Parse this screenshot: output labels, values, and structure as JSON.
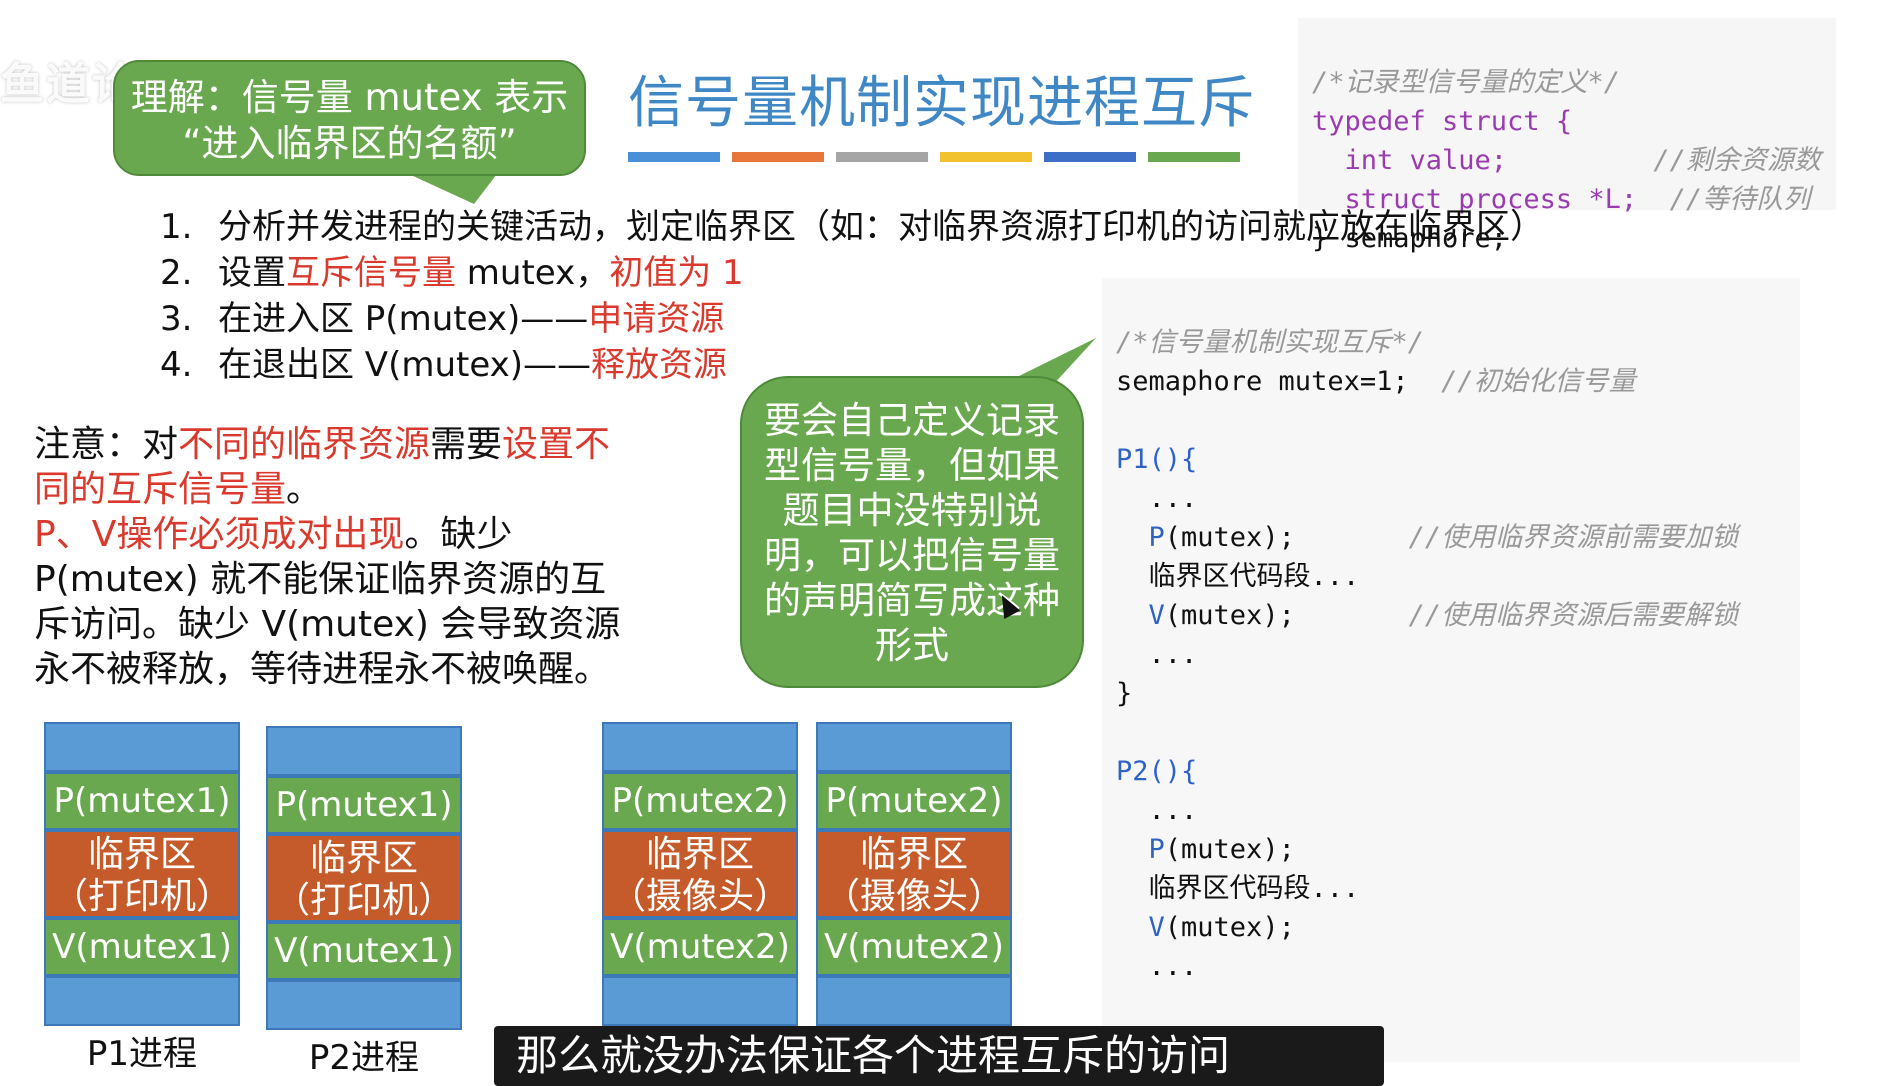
{
  "watermark": "鱼道论坛 bilibili",
  "title": "信号量机制实现进程互斥",
  "bubble_top": {
    "line1": "理解：信号量 mutex 表示",
    "line2": "“进入临界区的名额”"
  },
  "title_bar_colors": [
    "#4a90d9",
    "#e8763a",
    "#a5a5a5",
    "#f2c12e",
    "#3e6fc6",
    "#6aa84f"
  ],
  "code_top": {
    "comment": "/*记录型信号量的定义*/",
    "line1": "typedef struct {",
    "line2_code": "  int value;",
    "line2_comment": "//剩余资源数",
    "line3_code": "  struct process *L;",
    "line3_comment": "//等待队列",
    "line4": "} semaphore;"
  },
  "steps": [
    {
      "num": "1.",
      "text": "分析并发进程的关键活动，划定临界区（如：对临界资源打印机的访问就应放在临界区）"
    },
    {
      "num": "2.",
      "a": "设置",
      "b": "互斥信号量",
      "c": " mutex，",
      "d": "初值为 1"
    },
    {
      "num": "3.",
      "a": "在进入区 P(mutex)——",
      "b": "申请资源"
    },
    {
      "num": "4.",
      "a": "在退出区 V(mutex)——",
      "b": "释放资源"
    }
  ],
  "note": {
    "p1a": "注意：对",
    "p1b": "不同的临界资源",
    "p1c": "需要",
    "p1d": "设置不同的互斥信号量",
    "p1e": "。",
    "p2a": "P、V操作必须成对出现",
    "p2b": "。缺少 P(mutex) 就不能保证临界资源的互斥访问。缺少 V(mutex) 会导致资源永不被释放，等待进程永不被唤醒。"
  },
  "bubble_mid": "要会自己定义记录型信号量，但如果题目中没特别说明，可以把信号量的声明简写成这种形式",
  "code_main": {
    "comment": "/*信号量机制实现互斥*/",
    "decl": "semaphore mutex=1;",
    "decl_comment": "//初始化信号量",
    "p1_head": "P1(){",
    "p2_head": "P2(){",
    "dots": "...",
    "p_call": "(mutex);",
    "p_prefix": "P",
    "v_prefix": "V",
    "p_comment": "//使用临界资源前需要加锁",
    "v_comment": "//使用临界资源后需要解锁",
    "cs": "临界区代码段...",
    "close": "}"
  },
  "processes": [
    {
      "p": "P(mutex1)",
      "cs1": "临界区",
      "cs2": "（打印机）",
      "v": "V(mutex1)",
      "label": "P1进程"
    },
    {
      "p": "P(mutex1)",
      "cs1": "临界区",
      "cs2": "（打印机）",
      "v": "V(mutex1)",
      "label": "P2进程"
    },
    {
      "p": "P(mutex2)",
      "cs1": "临界区",
      "cs2": "（摄像头）",
      "v": "V(mutex2)",
      "label": ""
    },
    {
      "p": "P(mutex2)",
      "cs1": "临界区",
      "cs2": "（摄像头）",
      "v": "V(mutex2)",
      "label": ""
    }
  ],
  "subtitle": "那么就没办法保证各个进程互斥的访问"
}
